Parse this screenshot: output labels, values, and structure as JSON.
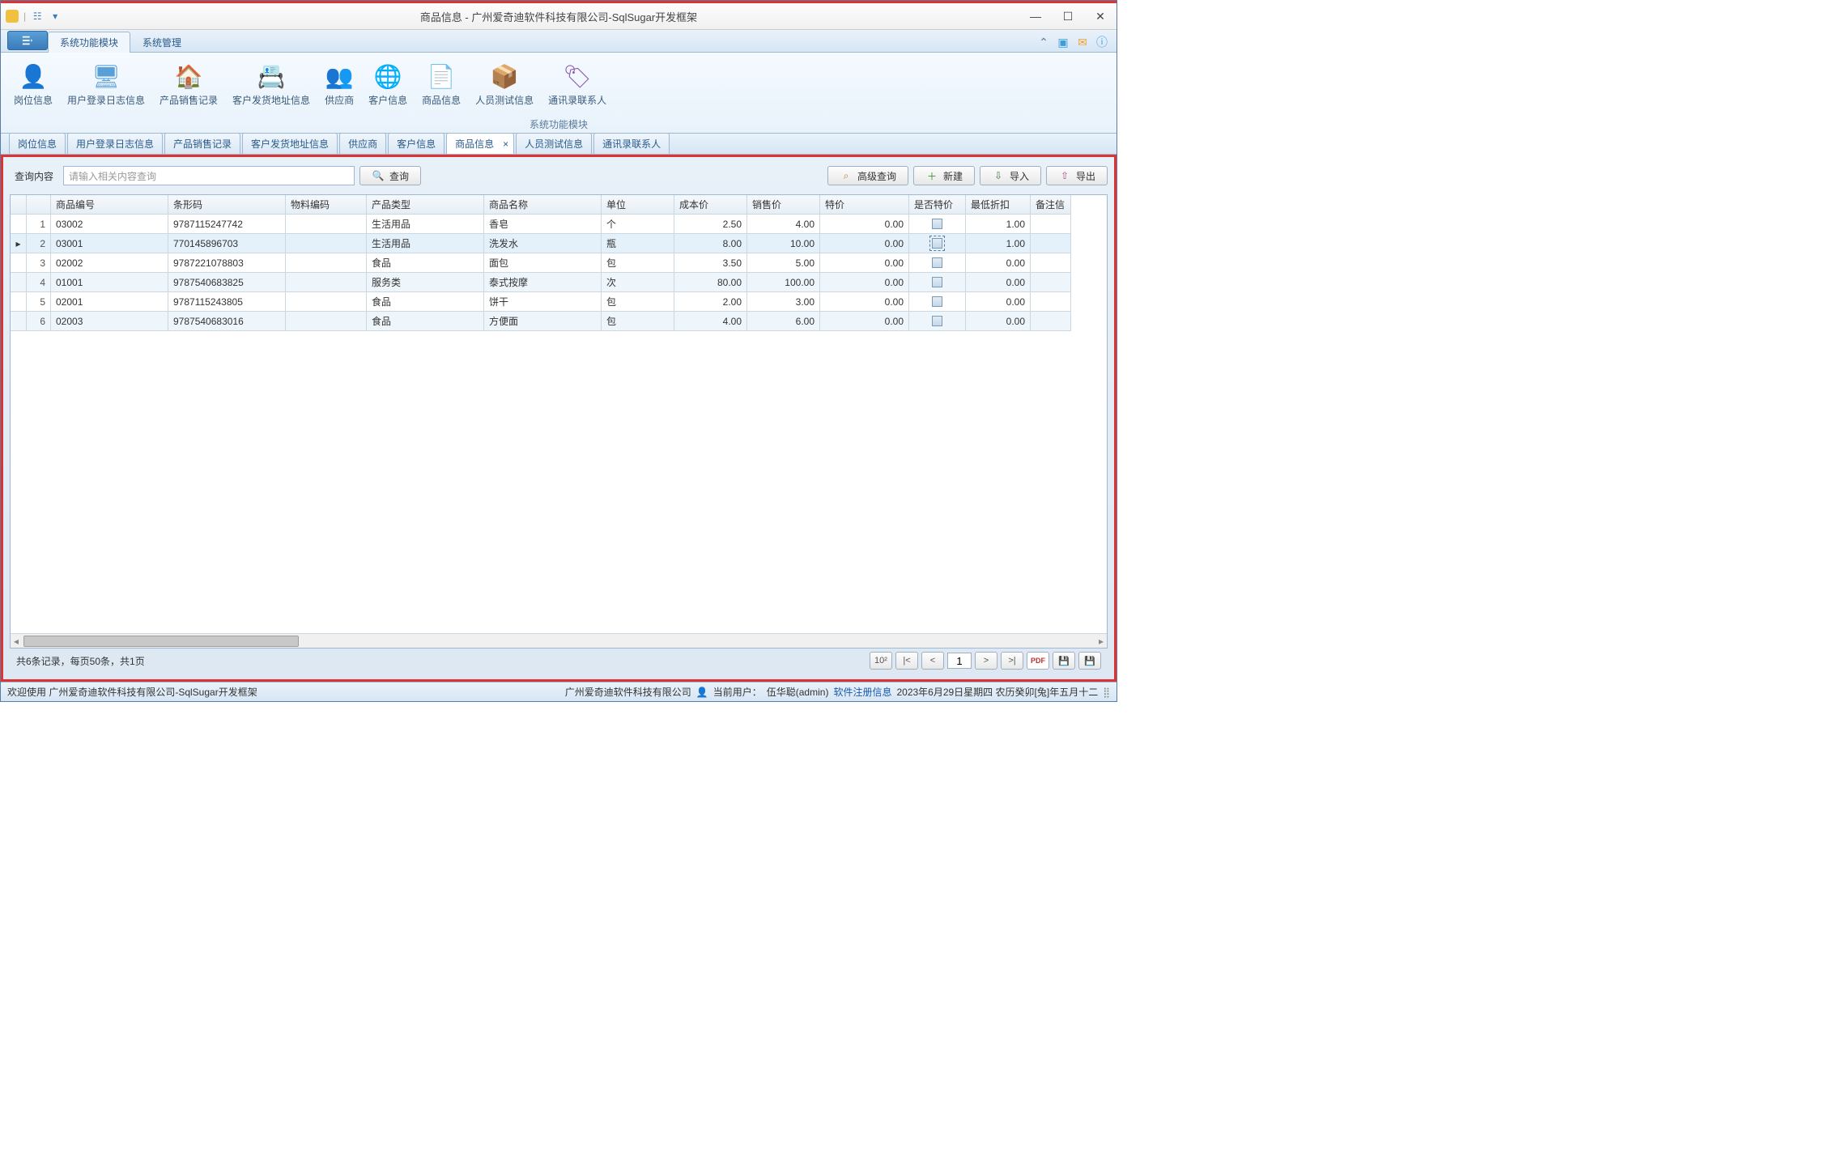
{
  "window": {
    "title": "商品信息 - 广州爱奇迪软件科技有限公司-SqlSugar开发框架"
  },
  "menu": {
    "tabs": [
      "系统功能模块",
      "系统管理"
    ],
    "active": 0,
    "group_title": "系统功能模块"
  },
  "ribbon": [
    {
      "label": "岗位信息",
      "icon": "user-icon"
    },
    {
      "label": "用户登录日志信息",
      "icon": "log-icon"
    },
    {
      "label": "产品销售记录",
      "icon": "house-icon"
    },
    {
      "label": "客户发货地址信息",
      "icon": "address-icon"
    },
    {
      "label": "供应商",
      "icon": "supplier-icon"
    },
    {
      "label": "客户信息",
      "icon": "globe-icon"
    },
    {
      "label": "商品信息",
      "icon": "product-icon"
    },
    {
      "label": "人员测试信息",
      "icon": "box-icon"
    },
    {
      "label": "通讯录联系人",
      "icon": "contact-icon"
    }
  ],
  "doc_tabs": {
    "items": [
      "岗位信息",
      "用户登录日志信息",
      "产品销售记录",
      "客户发货地址信息",
      "供应商",
      "客户信息",
      "商品信息",
      "人员测试信息",
      "通讯录联系人"
    ],
    "active": 6
  },
  "query": {
    "label": "查询内容",
    "placeholder": "请输入相关内容查询",
    "search_btn": "查询",
    "advanced": "高级查询",
    "new": "新建",
    "import": "导入",
    "export": "导出"
  },
  "grid": {
    "columns": [
      "商品编号",
      "条形码",
      "物料编码",
      "产品类型",
      "商品名称",
      "单位",
      "成本价",
      "销售价",
      "特价",
      "是否特价",
      "最低折扣",
      "备注信"
    ],
    "rows": [
      {
        "n": 1,
        "code": "03002",
        "barcode": "9787115247742",
        "material": "",
        "type": "生活用品",
        "name": "香皂",
        "unit": "个",
        "cost": "2.50",
        "sale": "4.00",
        "special": "0.00",
        "isspecial": false,
        "discount": "1.00"
      },
      {
        "n": 2,
        "code": "03001",
        "barcode": "770145896703",
        "material": "",
        "type": "生活用品",
        "name": "洗发水",
        "unit": "瓶",
        "cost": "8.00",
        "sale": "10.00",
        "special": "0.00",
        "isspecial": false,
        "discount": "1.00",
        "selected": true
      },
      {
        "n": 3,
        "code": "02002",
        "barcode": "9787221078803",
        "material": "",
        "type": "食品",
        "name": "面包",
        "unit": "包",
        "cost": "3.50",
        "sale": "5.00",
        "special": "0.00",
        "isspecial": false,
        "discount": "0.00"
      },
      {
        "n": 4,
        "code": "01001",
        "barcode": "9787540683825",
        "material": "",
        "type": "服务类",
        "name": "泰式按摩",
        "unit": "次",
        "cost": "80.00",
        "sale": "100.00",
        "special": "0.00",
        "isspecial": false,
        "discount": "0.00"
      },
      {
        "n": 5,
        "code": "02001",
        "barcode": "9787115243805",
        "material": "",
        "type": "食品",
        "name": "饼干",
        "unit": "包",
        "cost": "2.00",
        "sale": "3.00",
        "special": "0.00",
        "isspecial": false,
        "discount": "0.00"
      },
      {
        "n": 6,
        "code": "02003",
        "barcode": "9787540683016",
        "material": "",
        "type": "食品",
        "name": "方便面",
        "unit": "包",
        "cost": "4.00",
        "sale": "6.00",
        "special": "0.00",
        "isspecial": false,
        "discount": "0.00"
      }
    ]
  },
  "pager": {
    "summary": "共6条记录，每页50条，共1页",
    "page": "1",
    "first": "|<",
    "prev": "<",
    "next": ">",
    "last": ">|",
    "pagesize_label": "10²"
  },
  "statusbar": {
    "welcome": "欢迎使用 广州爱奇迪软件科技有限公司-SqlSugar开发框架",
    "company": "广州爱奇迪软件科技有限公司",
    "user_label": "当前用户：",
    "user": "伍华聪(admin)",
    "register": "软件注册信息",
    "datetime": "2023年6月29日星期四 农历癸卯[兔]年五月十二"
  }
}
